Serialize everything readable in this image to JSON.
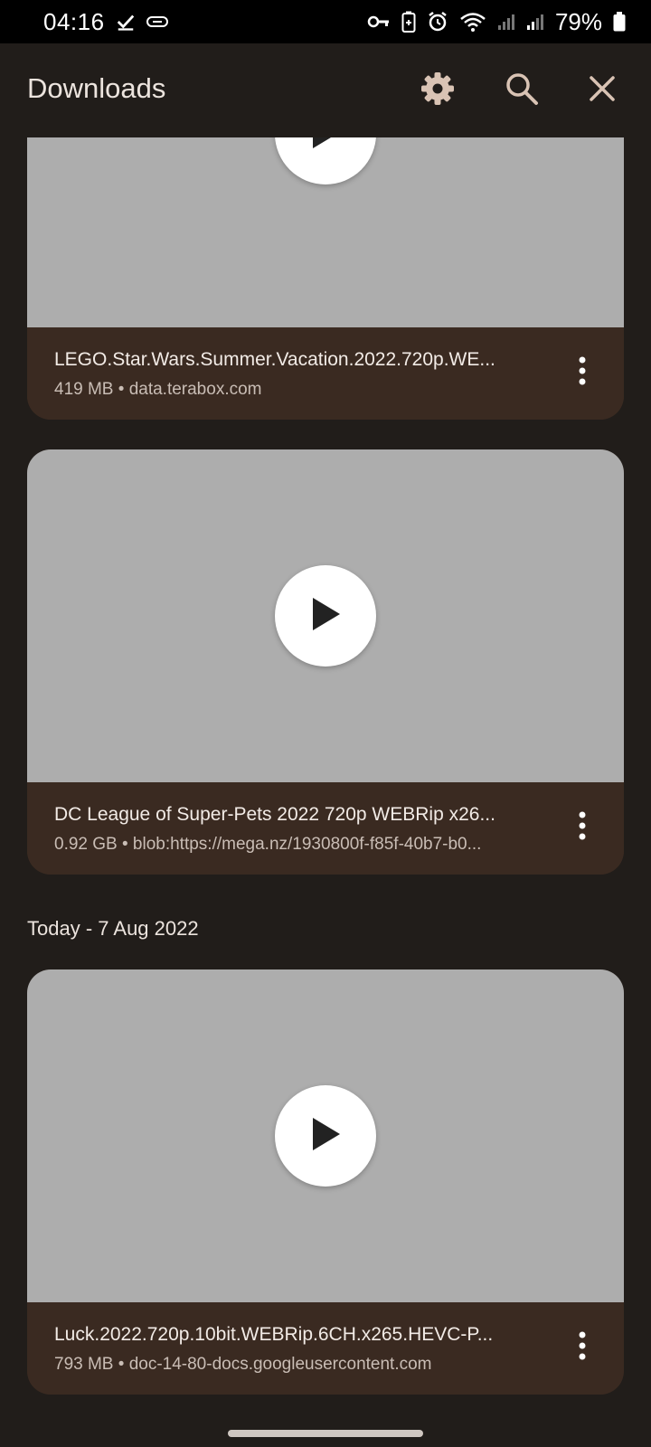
{
  "status_bar": {
    "time": "04:16",
    "battery": "79%"
  },
  "app_bar": {
    "title": "Downloads"
  },
  "sections": [
    {
      "header": "",
      "items": [
        {
          "name": "LEGO.Star.Wars.Summer.Vacation.2022.720p.WE...",
          "meta": "419 MB • data.terabox.com"
        },
        {
          "name": "DC League of Super-Pets 2022 720p WEBRip x26...",
          "meta": "0.92 GB • blob:https://mega.nz/1930800f-f85f-40b7-b0..."
        }
      ]
    },
    {
      "header": "Today - 7 Aug 2022",
      "items": [
        {
          "name": "Luck.2022.720p.10bit.WEBRip.6CH.x265.HEVC-P...",
          "meta": "793 MB • doc-14-80-docs.googleusercontent.com"
        }
      ]
    }
  ],
  "colors": {
    "background": "#211d1a",
    "card_info": "#3a2a21",
    "thumbnail": "#adadad"
  }
}
